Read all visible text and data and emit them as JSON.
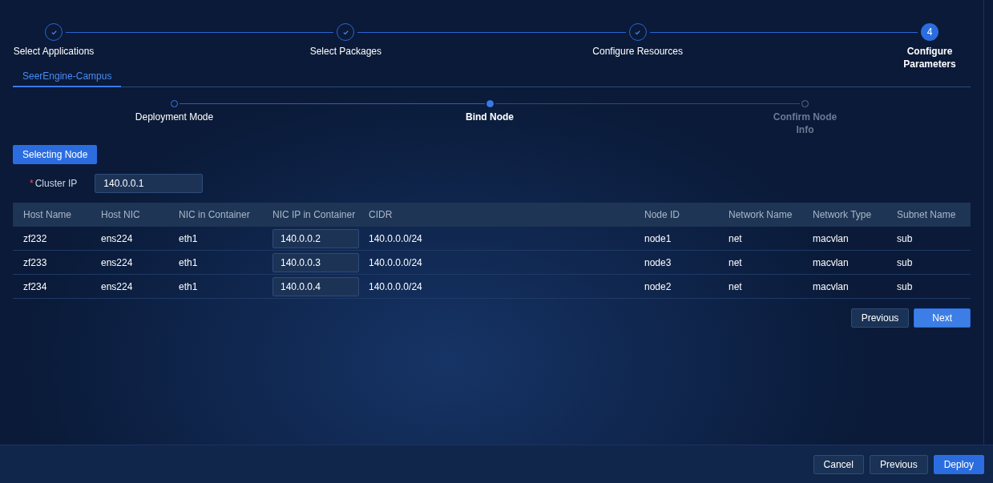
{
  "steps": [
    {
      "label": "Select Applications",
      "completed": true,
      "selected": false
    },
    {
      "label": "Select Packages",
      "completed": true,
      "selected": false
    },
    {
      "label": "Configure Resources",
      "completed": true,
      "selected": false
    },
    {
      "label": "Configure Parameters",
      "number": "4",
      "completed": false,
      "selected": true
    }
  ],
  "tabs": [
    {
      "label": "SeerEngine-Campus",
      "selected": true
    }
  ],
  "sub_steps": [
    {
      "label": "Deployment Mode",
      "completed": true,
      "selected": false
    },
    {
      "label": "Bind Node",
      "completed": false,
      "selected": true
    },
    {
      "label": "Confirm Node Info",
      "completed": false,
      "selected": false
    }
  ],
  "selecting_button": "Selecting Node",
  "cluster_ip": {
    "label": "Cluster IP",
    "required_mark": "*",
    "value": "140.0.0.1"
  },
  "table": {
    "columns": [
      "Host Name",
      "Host NIC",
      "NIC in Container",
      "NIC IP in Container",
      "CIDR",
      "Node ID",
      "Network Name",
      "Network Type",
      "Subnet Name"
    ],
    "rows": [
      [
        "zf232",
        "ens224",
        "eth1",
        "140.0.0.2",
        "140.0.0.0/24",
        "node1",
        "net",
        "macvlan",
        "sub"
      ],
      [
        "zf233",
        "ens224",
        "eth1",
        "140.0.0.3",
        "140.0.0.0/24",
        "node3",
        "net",
        "macvlan",
        "sub"
      ],
      [
        "zf234",
        "ens224",
        "eth1",
        "140.0.0.4",
        "140.0.0.0/24",
        "node2",
        "net",
        "macvlan",
        "sub"
      ]
    ]
  },
  "inner_buttons": [
    {
      "label": "Previous",
      "kind": "secondary"
    },
    {
      "label": "Next",
      "kind": "primary"
    }
  ],
  "footer_buttons": [
    {
      "label": "Cancel",
      "kind": "secondary"
    },
    {
      "label": "Previous",
      "kind": "secondary"
    },
    {
      "label": "Deploy",
      "kind": "primary"
    }
  ]
}
